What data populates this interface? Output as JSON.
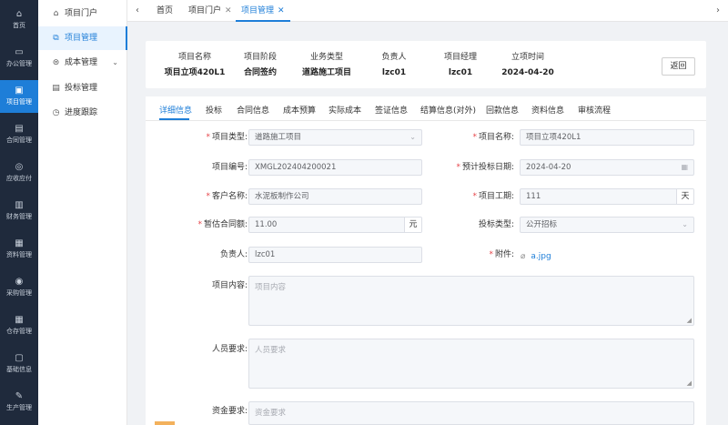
{
  "rail": [
    {
      "icon": "home-icon",
      "glyph": "⌂",
      "label": "首页"
    },
    {
      "icon": "monitor-icon",
      "glyph": "▭",
      "label": "办公管理"
    },
    {
      "icon": "briefcase-icon",
      "glyph": "▣",
      "label": "项目管理"
    },
    {
      "icon": "document-icon",
      "glyph": "▤",
      "label": "合同管理"
    },
    {
      "icon": "coin-icon",
      "glyph": "◎",
      "label": "应收应付"
    },
    {
      "icon": "wallet-icon",
      "glyph": "▥",
      "label": "财务管理"
    },
    {
      "icon": "file-icon",
      "glyph": "▦",
      "label": "资料管理"
    },
    {
      "icon": "purchase-icon",
      "glyph": "◉",
      "label": "采购管理"
    },
    {
      "icon": "grid-icon",
      "glyph": "▦",
      "label": "仓存管理"
    },
    {
      "icon": "info-icon",
      "glyph": "▢",
      "label": "基础信息"
    },
    {
      "icon": "wrench-icon",
      "glyph": "✎",
      "label": "生产管理"
    }
  ],
  "submenu": [
    {
      "icon": "home-icon",
      "glyph": "⌂",
      "label": "项目门户"
    },
    {
      "icon": "project-icon",
      "glyph": "⧉",
      "label": "项目管理"
    },
    {
      "icon": "cost-icon",
      "glyph": "⊜",
      "label": "成本管理"
    },
    {
      "icon": "bid-icon",
      "glyph": "▤",
      "label": "投标管理"
    },
    {
      "icon": "clock-icon",
      "glyph": "◷",
      "label": "进度跟踪"
    }
  ],
  "tabs": {
    "left_arrow": "‹",
    "right_arrow": "›",
    "items": [
      "首页",
      "项目门户",
      "项目管理"
    ],
    "close": "✕"
  },
  "summary": {
    "columns": [
      {
        "label": "项目名称",
        "value": "项目立项420L1"
      },
      {
        "label": "项目阶段",
        "value": "合同签约"
      },
      {
        "label": "业务类型",
        "value": "道路施工项目"
      },
      {
        "label": "负责人",
        "value": "lzc01"
      },
      {
        "label": "项目经理",
        "value": "lzc01"
      },
      {
        "label": "立项时间",
        "value": "2024-04-20"
      }
    ],
    "back_label": "返回"
  },
  "detail_tabs": [
    "详细信息",
    "投标",
    "合同信息",
    "成本预算",
    "实际成本",
    "签证信息",
    "结算信息(对外)",
    "回款信息",
    "资料信息",
    "审核流程"
  ],
  "form": {
    "project_type": {
      "label": "项目类型:",
      "value": "道路施工项目"
    },
    "project_name": {
      "label": "项目名称:",
      "value": "项目立项420L1"
    },
    "project_no": {
      "label": "项目编号:",
      "value": "XMGL202404200021"
    },
    "bid_date": {
      "label": "预计投标日期:",
      "value": "2024-04-20"
    },
    "client_name": {
      "label": "客户名称:",
      "value": "水泥板制作公司"
    },
    "duration": {
      "label": "项目工期:",
      "value": "111",
      "unit": "天"
    },
    "contract_amount": {
      "label": "暂估合同额:",
      "value": "11.00",
      "unit": "元"
    },
    "bid_type": {
      "label": "投标类型:",
      "value": "公开招标"
    },
    "owner": {
      "label": "负责人:",
      "value": "lzc01"
    },
    "attachment": {
      "label": "附件:",
      "value": "a.jpg"
    },
    "content": {
      "label": "项目内容:",
      "placeholder": "项目内容"
    },
    "staff": {
      "label": "人员要求:",
      "placeholder": "人员要求"
    },
    "funds": {
      "label": "资金要求:",
      "placeholder": "资金要求"
    }
  }
}
